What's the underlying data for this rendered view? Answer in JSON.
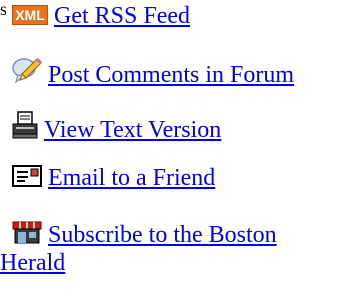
{
  "edge_text": "s",
  "tools": {
    "rss": {
      "icon_text": "XML",
      "icon": "xml-feed-icon",
      "label": "Get RSS Feed"
    },
    "forum": {
      "icon": "comment-pencil-icon",
      "label": "Post Comments in Forum"
    },
    "text_version": {
      "icon": "printer-icon",
      "label": "View Text Version"
    },
    "email": {
      "icon": "email-card-icon",
      "label": "Email to a Friend"
    },
    "subscribe": {
      "icon": "storefront-icon",
      "label_line1": "Subscribe to the Boston",
      "label_line2": "Herald"
    }
  },
  "colors": {
    "link": "#0000ee",
    "xml_badge": "#e8731c",
    "xml_badge_text": "#ffffff",
    "awning_red": "#c0201a"
  }
}
